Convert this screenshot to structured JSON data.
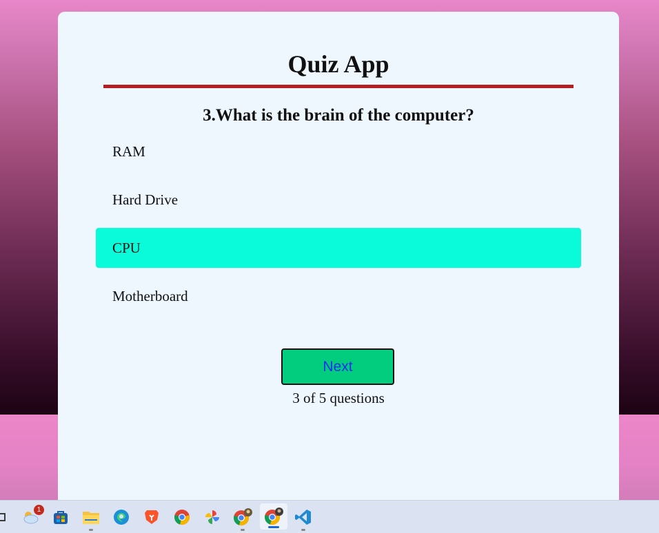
{
  "app": {
    "title": "Quiz App"
  },
  "quiz": {
    "question": "3.What is the brain of the computer?",
    "answers": [
      {
        "label": "RAM",
        "selected": false
      },
      {
        "label": "Hard Drive",
        "selected": false
      },
      {
        "label": "CPU",
        "selected": true
      },
      {
        "label": "Motherboard",
        "selected": false
      }
    ],
    "next_label": "Next",
    "progress_text": "3 of 5 questions"
  },
  "taskbar": {
    "weather_badge": "1",
    "icons": [
      "window-snip-icon",
      "weather-icon",
      "store-icon",
      "file-explorer-icon",
      "edge-icon",
      "brave-icon",
      "chrome-icon",
      "photos-icon",
      "chrome-profile-icon",
      "chrome-profile-active-icon",
      "vscode-icon"
    ]
  },
  "colors": {
    "accent_divider": "#b41e22",
    "selected_answer": "#09fbd9",
    "next_button": "#02cc7e",
    "next_text": "#1530f0",
    "card_background": "#eef7fd"
  }
}
